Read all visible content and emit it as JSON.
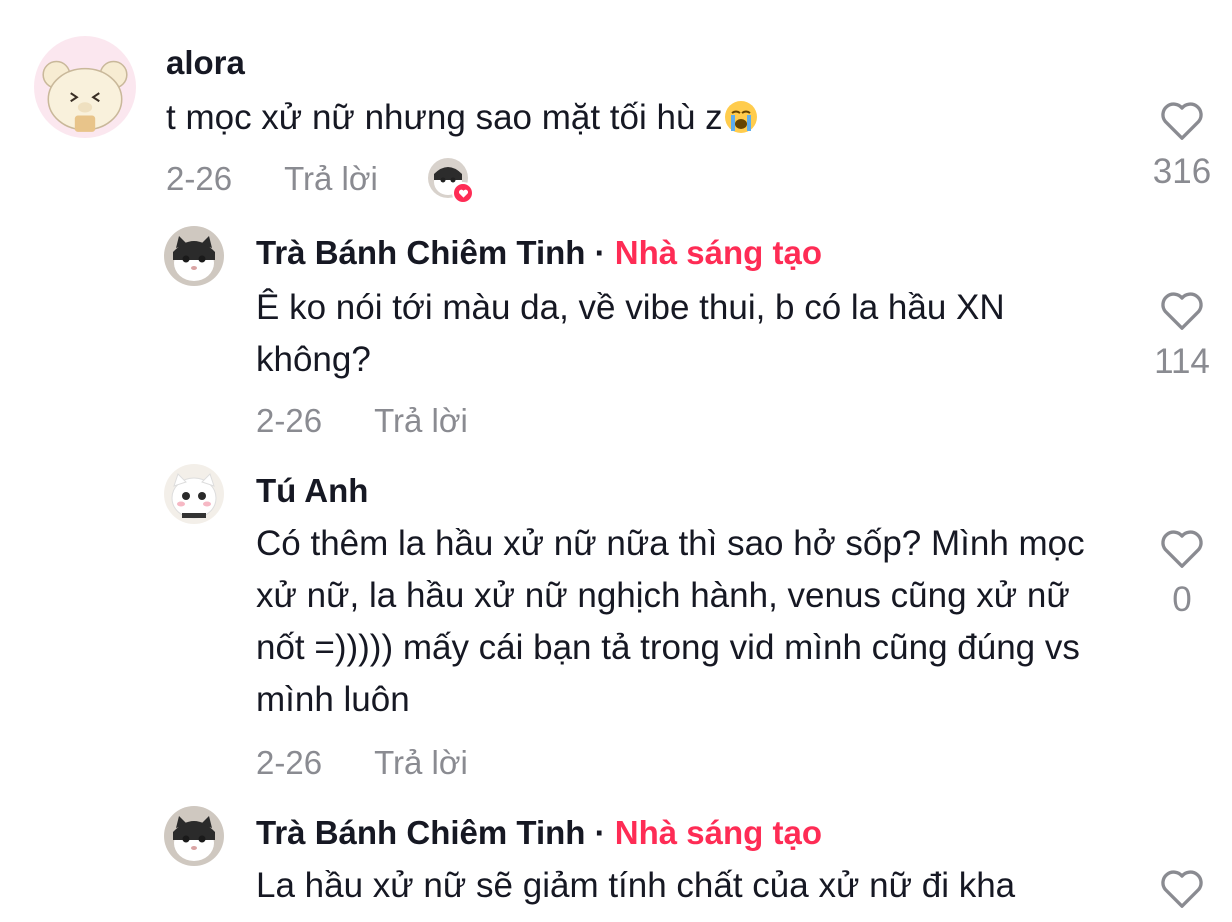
{
  "comments": [
    {
      "username": "alora",
      "text": "t mọc xử nữ nhưng sao mặt tối hù z",
      "emoji": "loudly-crying-face",
      "date": "2-26",
      "reply_label": "Trả lời",
      "likes": "316"
    },
    {
      "username": "Trà Bánh Chiêm Tinh",
      "separator": "·",
      "badge": "Nhà sáng tạo",
      "text": "Ê ko nói tới màu da, về vibe thui, b có la hầu XN không?",
      "date": "2-26",
      "reply_label": "Trả lời",
      "likes": "114"
    },
    {
      "username": "Tú Anh",
      "text": "Có thêm la hầu xử nữ nữa thì sao hở sốp? Mình mọc xử nữ, la hầu xử nữ nghịch hành, venus cũng xử nữ nốt =))))) mấy cái bạn tả trong vid mình cũng đúng vs mình luôn",
      "date": "2-26",
      "reply_label": "Trả lời",
      "likes": "0"
    },
    {
      "username": "Trà Bánh Chiêm Tinh",
      "separator": "·",
      "badge": "Nhà sáng tạo",
      "text": "La hầu xử nữ sẽ giảm tính chất của xử nữ đi kha"
    }
  ],
  "colors": {
    "text": "#161823",
    "secondary": "#8a8b91",
    "creator_badge": "#fe2c55",
    "heart_outline": "#8a8b91"
  },
  "icons": {
    "like": "heart-outline-icon",
    "liked_by_creator": "creator-liked-heart-icon"
  }
}
